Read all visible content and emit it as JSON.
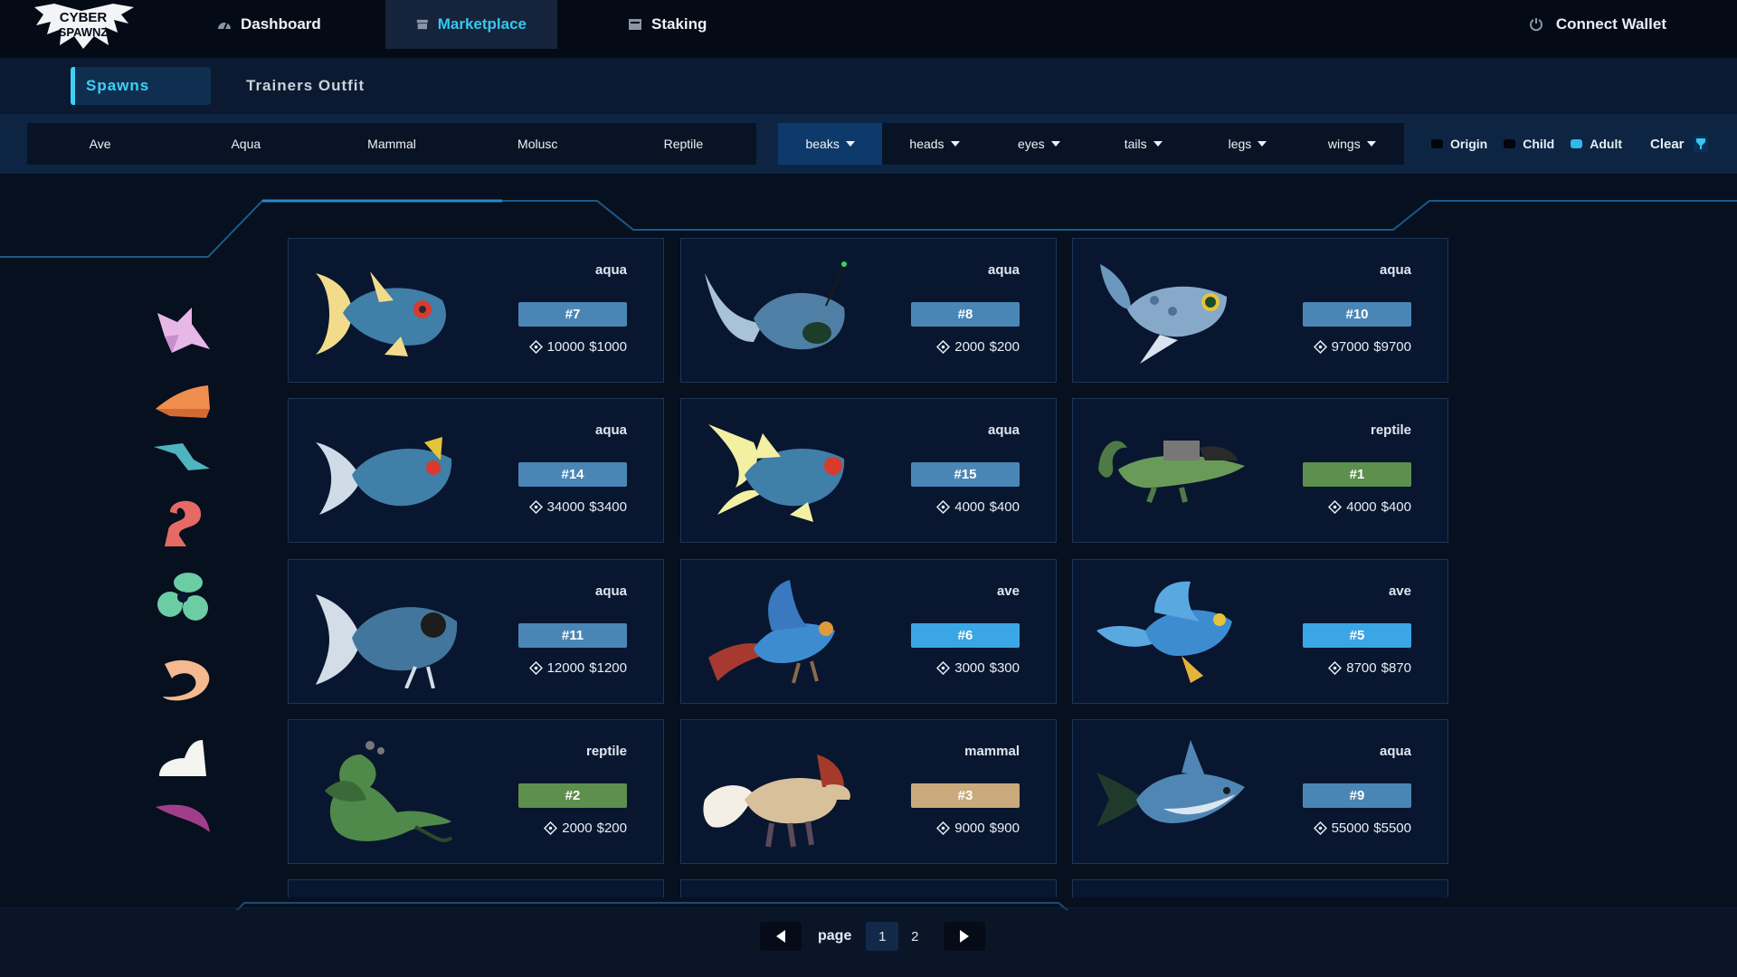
{
  "nav": {
    "items": [
      {
        "label": "Dashboard",
        "icon": "gauge-icon"
      },
      {
        "label": "Marketplace",
        "icon": "store-icon"
      },
      {
        "label": "Staking",
        "icon": "archive-icon"
      }
    ],
    "connect_label": "Connect Wallet",
    "logo_text": "CYBER SPAWNZ"
  },
  "subtabs": [
    "Spawns",
    "Trainers Outfit"
  ],
  "classes": [
    "Ave",
    "Aqua",
    "Mammal",
    "Molusc",
    "Reptile"
  ],
  "parts": [
    "beaks",
    "heads",
    "eyes",
    "tails",
    "legs",
    "wings"
  ],
  "stages": [
    {
      "label": "Origin",
      "checked": false
    },
    {
      "label": "Child",
      "checked": false
    },
    {
      "label": "Adult",
      "checked": true
    }
  ],
  "clear_label": "Clear",
  "side_icons": [
    "fox-head-icon",
    "beak-icon",
    "fin-icon",
    "tail-icon",
    "leaf-cluster-icon",
    "tentacle-icon",
    "foot-icon",
    "wing-icon"
  ],
  "colors": {
    "aqua": "#4a86b5",
    "ave": "#3aa6e6",
    "reptile": "#5d8f4e",
    "mammal": "#c9aa7c",
    "accent": "#3fd0f6"
  },
  "cards": [
    {
      "class": "aqua",
      "id": "#7",
      "tokens": "10000",
      "usd": "$1000",
      "art": "aqua-fish-yellow-fins"
    },
    {
      "class": "aqua",
      "id": "#8",
      "tokens": "2000",
      "usd": "$200",
      "art": "aqua-anglerfish"
    },
    {
      "class": "aqua",
      "id": "#10",
      "tokens": "97000",
      "usd": "$9700",
      "art": "aqua-spotted-fish"
    },
    {
      "class": "aqua",
      "id": "#14",
      "tokens": "34000",
      "usd": "$3400",
      "art": "aqua-fish-striped"
    },
    {
      "class": "aqua",
      "id": "#15",
      "tokens": "4000",
      "usd": "$400",
      "art": "aqua-fish-yellow-spikes"
    },
    {
      "class": "reptile",
      "id": "#1",
      "tokens": "4000",
      "usd": "$400",
      "art": "reptile-lizard"
    },
    {
      "class": "aqua",
      "id": "#11",
      "tokens": "12000",
      "usd": "$1200",
      "art": "aqua-catfish"
    },
    {
      "class": "ave",
      "id": "#6",
      "tokens": "3000",
      "usd": "$300",
      "art": "ave-bird-red-tail"
    },
    {
      "class": "ave",
      "id": "#5",
      "tokens": "8700",
      "usd": "$870",
      "art": "ave-bird-yellow-feet"
    },
    {
      "class": "reptile",
      "id": "#2",
      "tokens": "2000",
      "usd": "$200",
      "art": "reptile-seahorse-dragon"
    },
    {
      "class": "mammal",
      "id": "#3",
      "tokens": "9000",
      "usd": "$900",
      "art": "mammal-fox"
    },
    {
      "class": "aqua",
      "id": "#9",
      "tokens": "55000",
      "usd": "$5500",
      "art": "aqua-shark"
    }
  ],
  "pager": {
    "label": "page",
    "pages": [
      "1",
      "2"
    ],
    "current": "1"
  }
}
